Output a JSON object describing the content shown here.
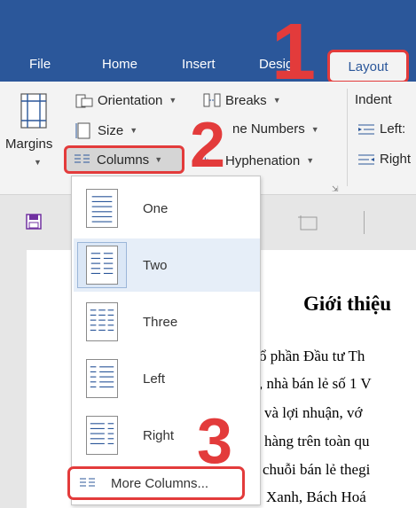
{
  "tabs": {
    "file": "File",
    "home": "Home",
    "insert": "Insert",
    "design": "Desig",
    "layout": "Layout"
  },
  "ribbon": {
    "margins": "Margins",
    "orientation": "Orientation",
    "size": "Size",
    "columns": "Columns",
    "breaks": "Breaks",
    "line_numbers": "ne Numbers",
    "hyphenation": "Hyphenation",
    "indent": "Indent",
    "left": "Left:",
    "right": "Right"
  },
  "columns_menu": {
    "items": [
      "One",
      "Two",
      "Three",
      "Left",
      "Right"
    ],
    "selected": "Two",
    "more": "More Columns..."
  },
  "annotations": [
    "1",
    "2",
    "3"
  ],
  "document": {
    "title": "Giới thiệu",
    "lines": [
      "ổ phần Đầu tư Th",
      ", nhà bán lẻ số 1 V",
      "và lợi nhuận, vớ",
      "hàng trên toàn qu",
      "chuỗi bán lẻ thegi",
      "Xanh, Bách Hoá"
    ]
  },
  "colors": {
    "accent": "#2b579a",
    "annotation": "#e33b3b"
  }
}
